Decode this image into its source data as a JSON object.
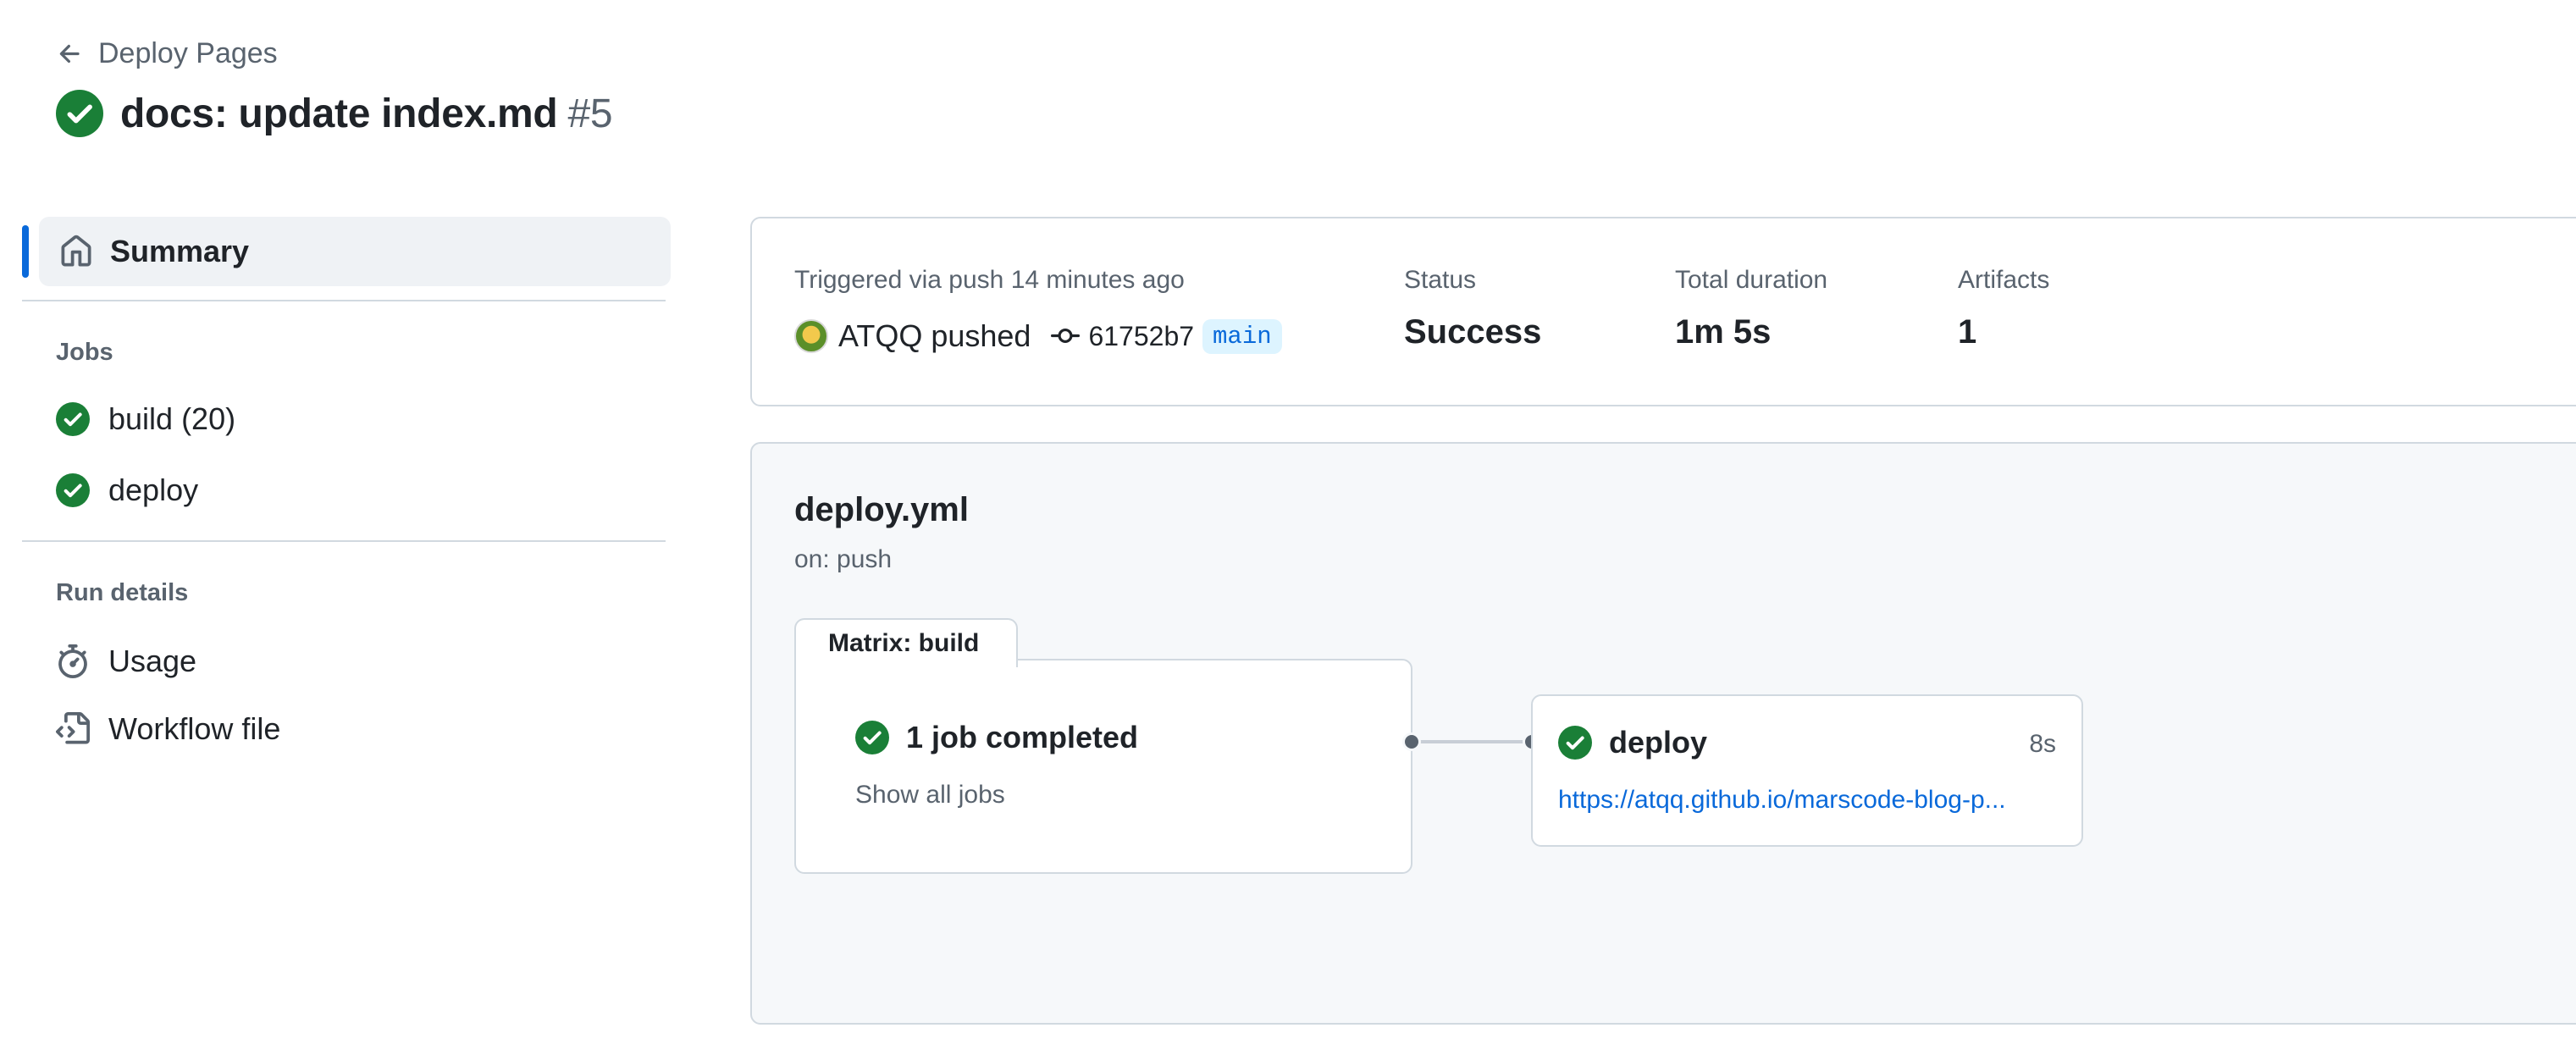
{
  "header": {
    "back_label": "Deploy Pages",
    "run_title": "docs: update index.md",
    "run_number": "#5"
  },
  "sidebar": {
    "summary_label": "Summary",
    "jobs_heading": "Jobs",
    "jobs": [
      {
        "label": "build (20)",
        "status": "success"
      },
      {
        "label": "deploy",
        "status": "success"
      }
    ],
    "run_details_heading": "Run details",
    "run_details": [
      {
        "label": "Usage",
        "icon": "stopwatch-icon"
      },
      {
        "label": "Workflow file",
        "icon": "file-code-icon"
      }
    ]
  },
  "summary": {
    "trigger_text": "Triggered via push 14 minutes ago",
    "pusher_text": "ATQQ pushed",
    "commit_sha": "61752b7",
    "branch": "main",
    "status_label": "Status",
    "status_value": "Success",
    "duration_label": "Total duration",
    "duration_value": "1m 5s",
    "artifacts_label": "Artifacts",
    "artifacts_value": "1"
  },
  "workflow": {
    "file_name": "deploy.yml",
    "trigger": "on: push",
    "matrix": {
      "tab_label": "Matrix: build",
      "status_text": "1 job completed",
      "show_all_label": "Show all jobs"
    },
    "deploy_job": {
      "name": "deploy",
      "duration": "8s",
      "url": "https://atqq.github.io/marscode-blog-p..."
    }
  },
  "colors": {
    "success": "#1a7f37",
    "accent": "#0969da",
    "muted_text": "#59636e",
    "border": "#d1d9e0",
    "panel_bg": "#f6f8fa"
  }
}
